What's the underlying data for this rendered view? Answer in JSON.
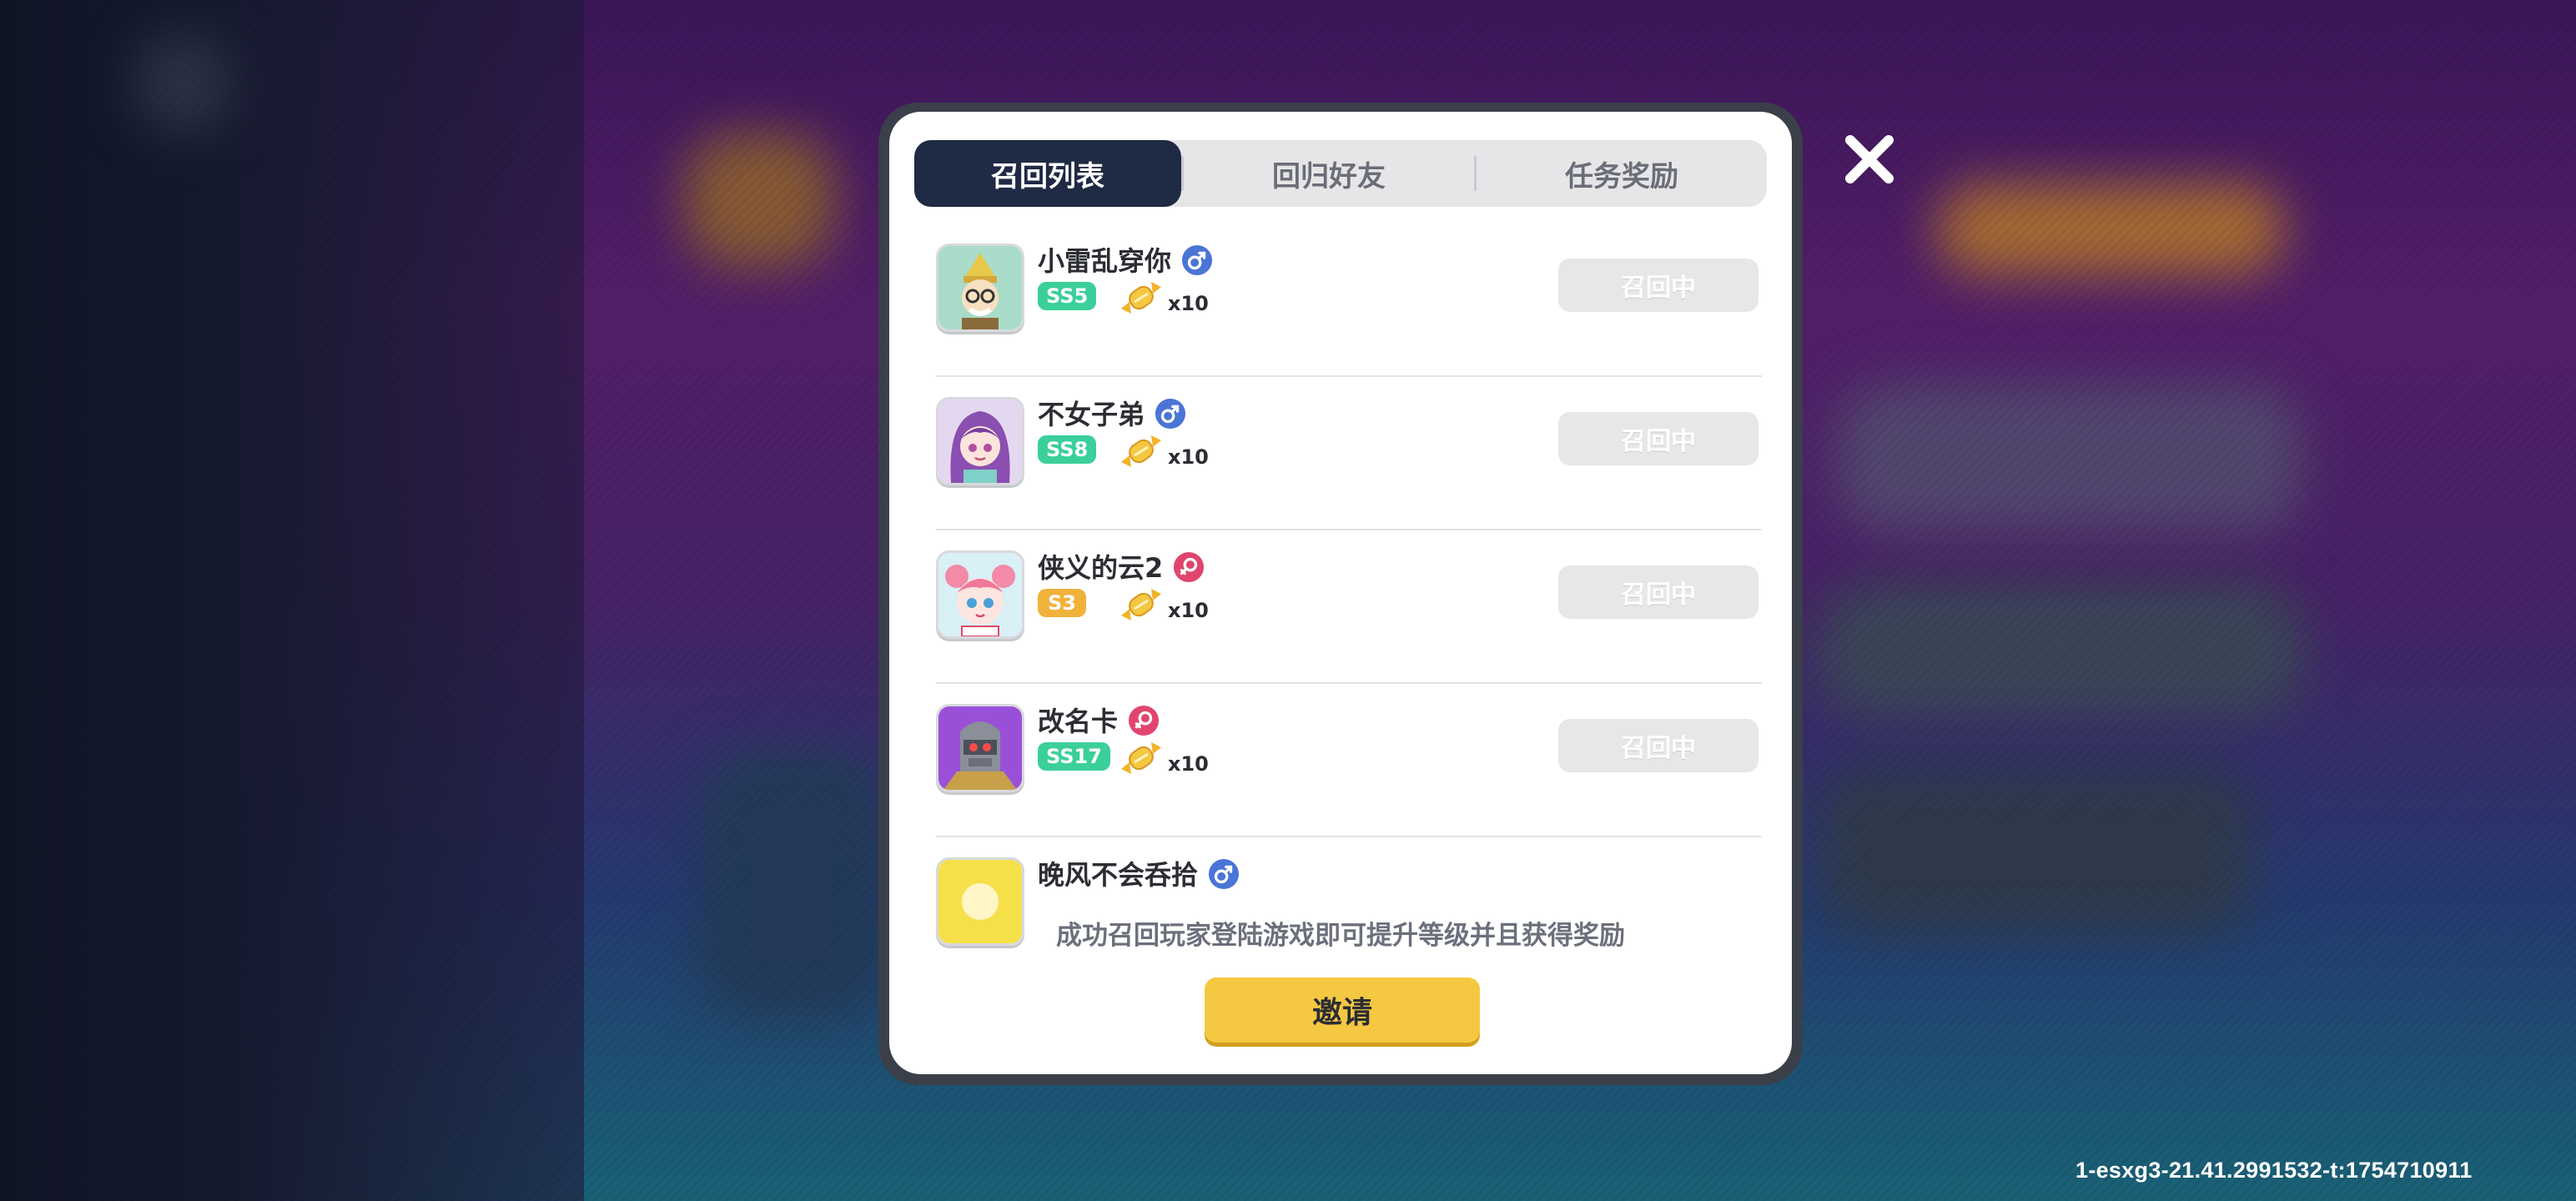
{
  "tabs": [
    {
      "label": "召回列表",
      "active": true
    },
    {
      "label": "回归好友",
      "active": false
    },
    {
      "label": "任务奖励",
      "active": false
    }
  ],
  "players": [
    {
      "name": "小雷乱穿你",
      "gender": "male",
      "rank": "SS5",
      "rank_color": "#3bcf9a",
      "quantity": "x10",
      "status": "召回中",
      "avatar": "gold-helmet-glasses-character"
    },
    {
      "name": "不女子弟",
      "gender": "male",
      "rank": "SS8",
      "rank_color": "#3bcf9a",
      "quantity": "x10",
      "status": "召回中",
      "avatar": "purple-hair-girl-character"
    },
    {
      "name": "侠义的云2",
      "gender": "female",
      "rank": "S3",
      "rank_color": "#f0b23a",
      "quantity": "x10",
      "status": "召回中",
      "avatar": "pink-hair-girl-character"
    },
    {
      "name": "改名卡",
      "gender": "female",
      "rank": "SS17",
      "rank_color": "#3bcf9a",
      "quantity": "x10",
      "status": "召回中",
      "avatar": "armored-robot-character"
    },
    {
      "name": "晚风不会呑拾",
      "gender": "male",
      "rank": "",
      "rank_color": "#3bcf9a",
      "quantity": "",
      "status": "",
      "avatar": "yellow-character"
    }
  ],
  "hint": "成功召回玩家登陆游戏即可提升等级并且获得奖励",
  "invite_label": "邀请",
  "close_icon": "close-icon",
  "build_info": "1-esxg3-21.41.2991532-t:1754710911",
  "colors": {
    "tab_active": "#1f2a44",
    "invite_button": "#f5c842",
    "male": "#4a74d6",
    "female": "#e0456e"
  }
}
